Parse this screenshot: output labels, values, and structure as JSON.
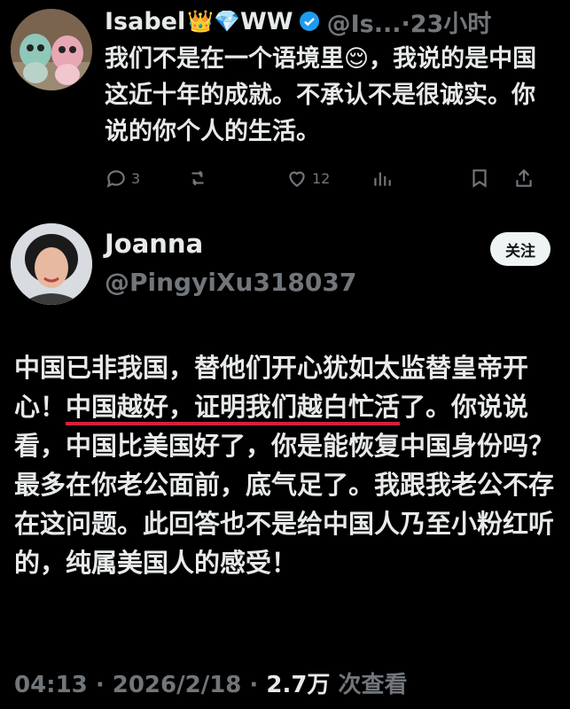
{
  "tweet1": {
    "name": "Isabel",
    "emoji_badges": "👑💎",
    "name_suffix": "WW",
    "handle": "@Is...·23小时",
    "text": "我们不是在一个语境里😌，我说的是中国这近十年的成就。不承认不是很诚实。你说的你个人的生活。",
    "actions": {
      "replies": "3",
      "reposts": "",
      "likes": "12",
      "views": ""
    }
  },
  "tweet2": {
    "name": "Joanna",
    "handle": "@PingyiXu318037",
    "follow_label": "关注",
    "text_before": "中国已非我国，替他们开心犹如太监替皇帝开心！",
    "text_highlight": "中国越好，证明我们越白忙活",
    "text_after": "了。你说说看，中国比美国好了，你是能恢复中国身份吗？最多在你老公面前，底气足了。我跟我老公不存在这问题。此回答也不是给中国人乃至小粉红听的，纯属美国人的感受！",
    "meta_time": "04:13 · 2026/2/18 · ",
    "meta_views": "2.7万",
    "meta_views_label": " 次查看"
  },
  "colors": {
    "background": "#000000",
    "text": "#e7e9ea",
    "muted": "#71767b",
    "verified": "#1d9bf0",
    "highlight_underline": "#d4213d"
  }
}
